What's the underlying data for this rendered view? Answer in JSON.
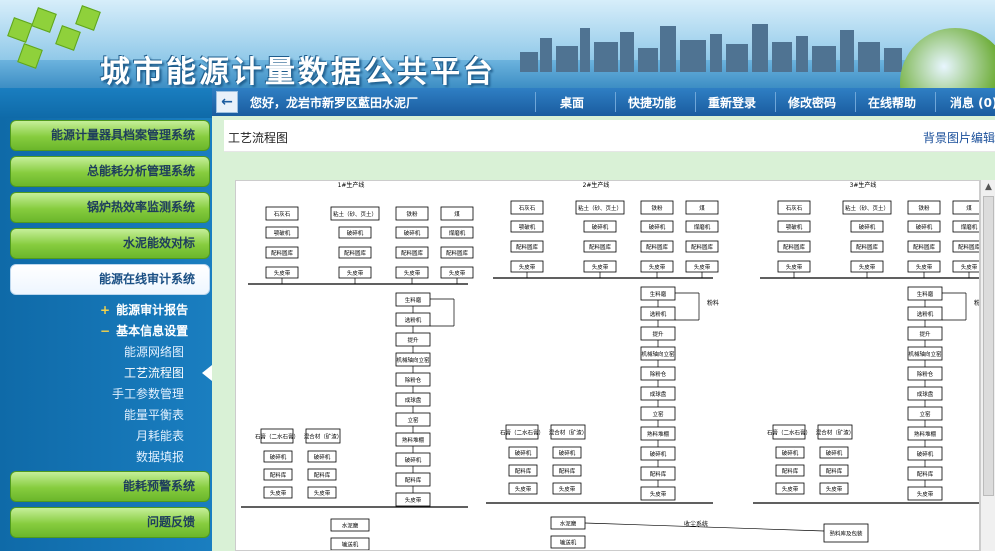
{
  "header": {
    "title": "城市能源计量数据公共平台"
  },
  "navbar": {
    "greeting": "您好，龙岩市新罗区藍田水泥厂",
    "links": [
      "桌面",
      "快捷功能",
      "重新登录",
      "修改密码",
      "在线帮助",
      "消息 (0)"
    ]
  },
  "sidebar": {
    "items": [
      {
        "label": "能源计量器具档案管理系统",
        "active": false
      },
      {
        "label": "总能耗分析管理系统",
        "active": false
      },
      {
        "label": "锅炉热效率监测系统",
        "active": false
      },
      {
        "label": "水泥能效对标",
        "active": false
      },
      {
        "label": "能源在线审计系统",
        "active": true
      },
      {
        "label": "能耗预警系统",
        "active": false
      },
      {
        "label": "问题反馈",
        "active": false
      }
    ],
    "subsections": [
      {
        "sign": "+",
        "label": "能源审计报告"
      },
      {
        "sign": "−",
        "label": "基本信息设置"
      }
    ],
    "subitems": [
      "能源网络图",
      "工艺流程图",
      "手工参数管理",
      "能量平衡表",
      "月耗能表",
      "数据填报"
    ],
    "current_subitem": "工艺流程图"
  },
  "content": {
    "breadcrumb": "工艺流程图",
    "bg_edit_link": "背景图片编辑"
  },
  "diagram": {
    "lines": [
      "1#生产线",
      "2#生产线",
      "3#生产线"
    ],
    "raw_boxes": [
      "石灰石",
      "粘土（砂、页土）",
      "铁粉",
      "煤"
    ],
    "mid_boxes": [
      "颚破机",
      "破碎机",
      "破碎机",
      "煤磨机"
    ],
    "store_boxes": [
      "配料圆库",
      "配料圆库",
      "配料圆库",
      "配料圆库"
    ],
    "belt_boxes": [
      "头皮带",
      "头皮带",
      "头皮带",
      "头皮带"
    ],
    "process_col": [
      "生料磨",
      "选粉机",
      "提升",
      "机械轴向立窑",
      "除粉仓",
      "成球盘",
      "立窑",
      "熟料堆棚",
      "破碎机",
      "配料库",
      "头皮带"
    ],
    "bottom_left": [
      "石膏（二水石膏）",
      "混合材（矿渣）"
    ],
    "bottom_mid": [
      "破碎机",
      "破碎机"
    ],
    "bottom_store": [
      "配料库",
      "配料库"
    ],
    "bottom_belt": [
      "头皮带",
      "头皮带"
    ],
    "final": [
      "水泥磨",
      "输送机"
    ],
    "side_note": "粉料",
    "kiln_note": "熟料库及包装",
    "dust_note": "收尘系统"
  }
}
